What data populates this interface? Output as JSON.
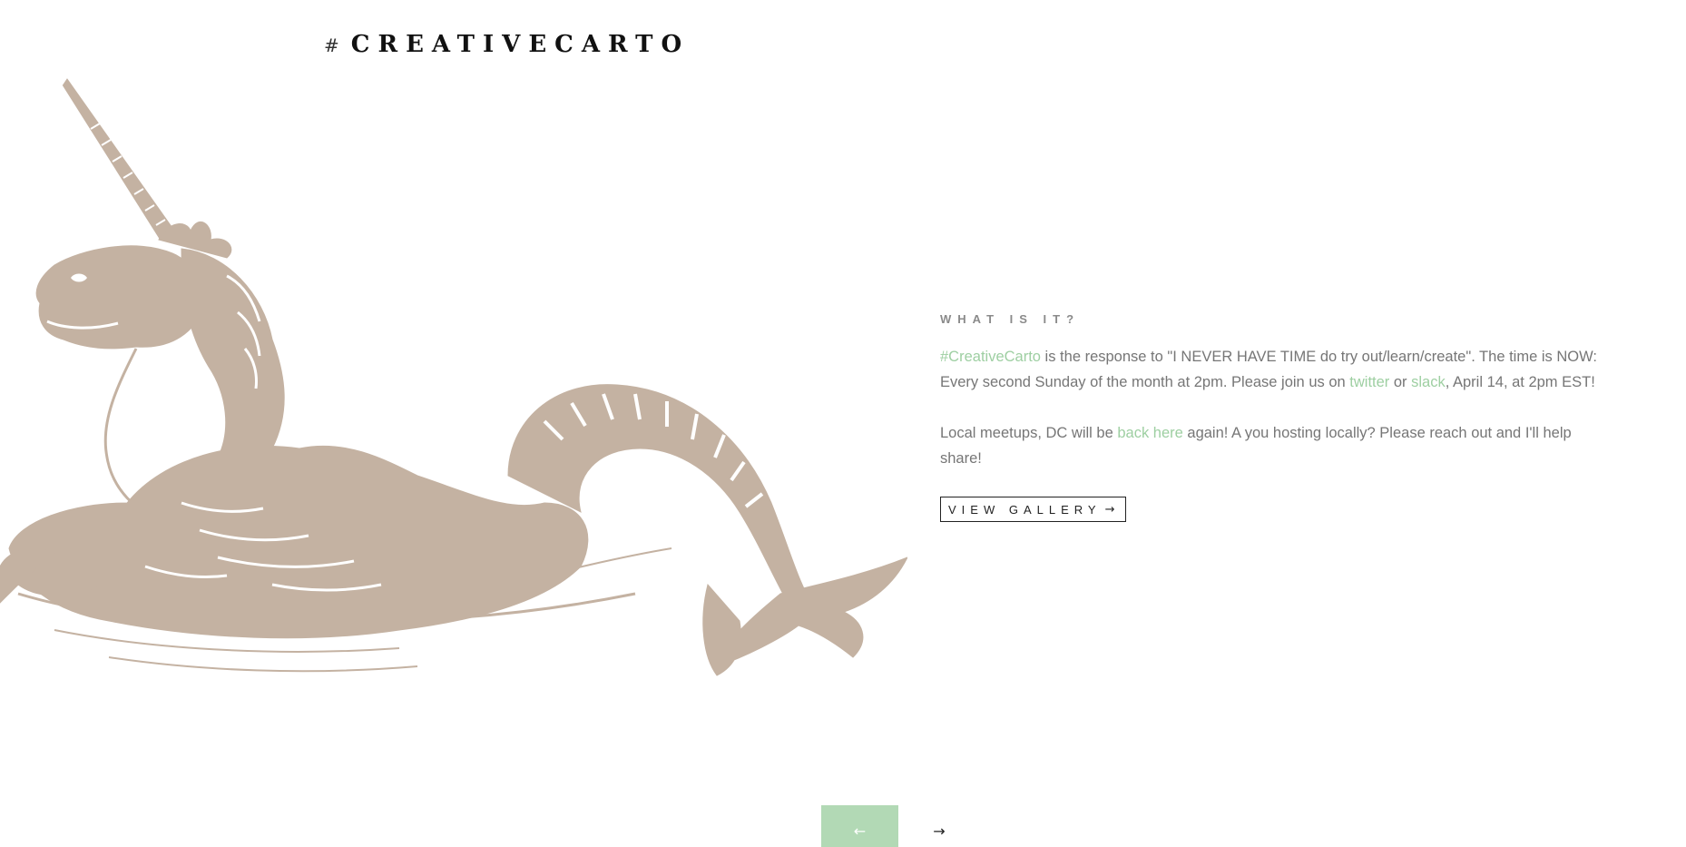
{
  "site": {
    "hash": "#",
    "brand": "CREATIVECARTO"
  },
  "hero": {
    "image_semantic": "sea-unicorn-illustration",
    "image_color": "#c4b2a2"
  },
  "intro": {
    "kicker": "WHAT IS IT?",
    "p1": {
      "link_hashtag": "#CreativeCarto",
      "text_a": " is the response to \"I NEVER HAVE TIME do try out/learn/create\". The time is NOW: Every second Sunday of the month at 2pm. Please join us on ",
      "link_twitter": "twitter",
      "text_b": " or ",
      "link_slack": "slack",
      "text_c": ", April 14, at 2pm EST!"
    },
    "p2": {
      "text_a": "Local meetups, DC will be ",
      "link_back": "back here",
      "text_b": " again! A you hosting locally? Please reach out and I'll help share!"
    },
    "button_label": "VIEW GALLERY",
    "button_icon": "arrow-right-icon"
  },
  "pager": {
    "prev_icon": "arrow-left-icon",
    "next_icon": "arrow-right-icon"
  },
  "colors": {
    "accent_green": "#b2d9b5",
    "link_green": "#9ecfa2",
    "text_gray": "#767676",
    "illustration_tan": "#c4b2a2"
  }
}
